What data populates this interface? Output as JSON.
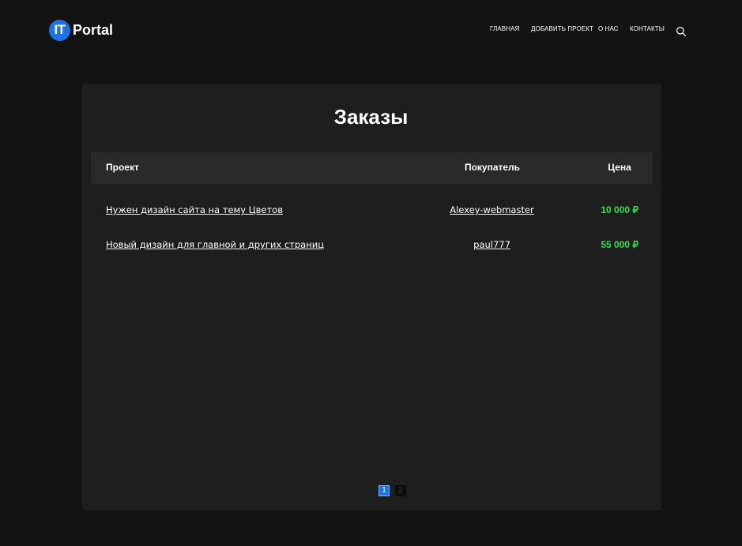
{
  "header": {
    "logo": {
      "badge": "IT",
      "text": "Portal",
      "badge_color": "#1a73e8"
    },
    "nav": [
      "ГЛАВНАЯ",
      "ДОБАВИТЬ ПРОЕКТ",
      "О НАС",
      "КОНТАКТЫ"
    ],
    "search_icon": "search-icon"
  },
  "main": {
    "title": "Заказы",
    "columns": [
      "Проект",
      "Покупатель",
      "Цена"
    ],
    "rows": [
      {
        "project": "Нужен дизайн сайта на тему Цветов",
        "buyer": "Alexey-webmaster",
        "price": "10 000 ₽"
      },
      {
        "project": "Новый дизайн для главной и других страниц",
        "buyer": "paul777",
        "price": "55 000 ₽"
      }
    ],
    "price_color": "#2ee050"
  },
  "pagination": {
    "pages": [
      "1",
      "2"
    ],
    "current": "1",
    "active_color": "#1a73e8"
  }
}
